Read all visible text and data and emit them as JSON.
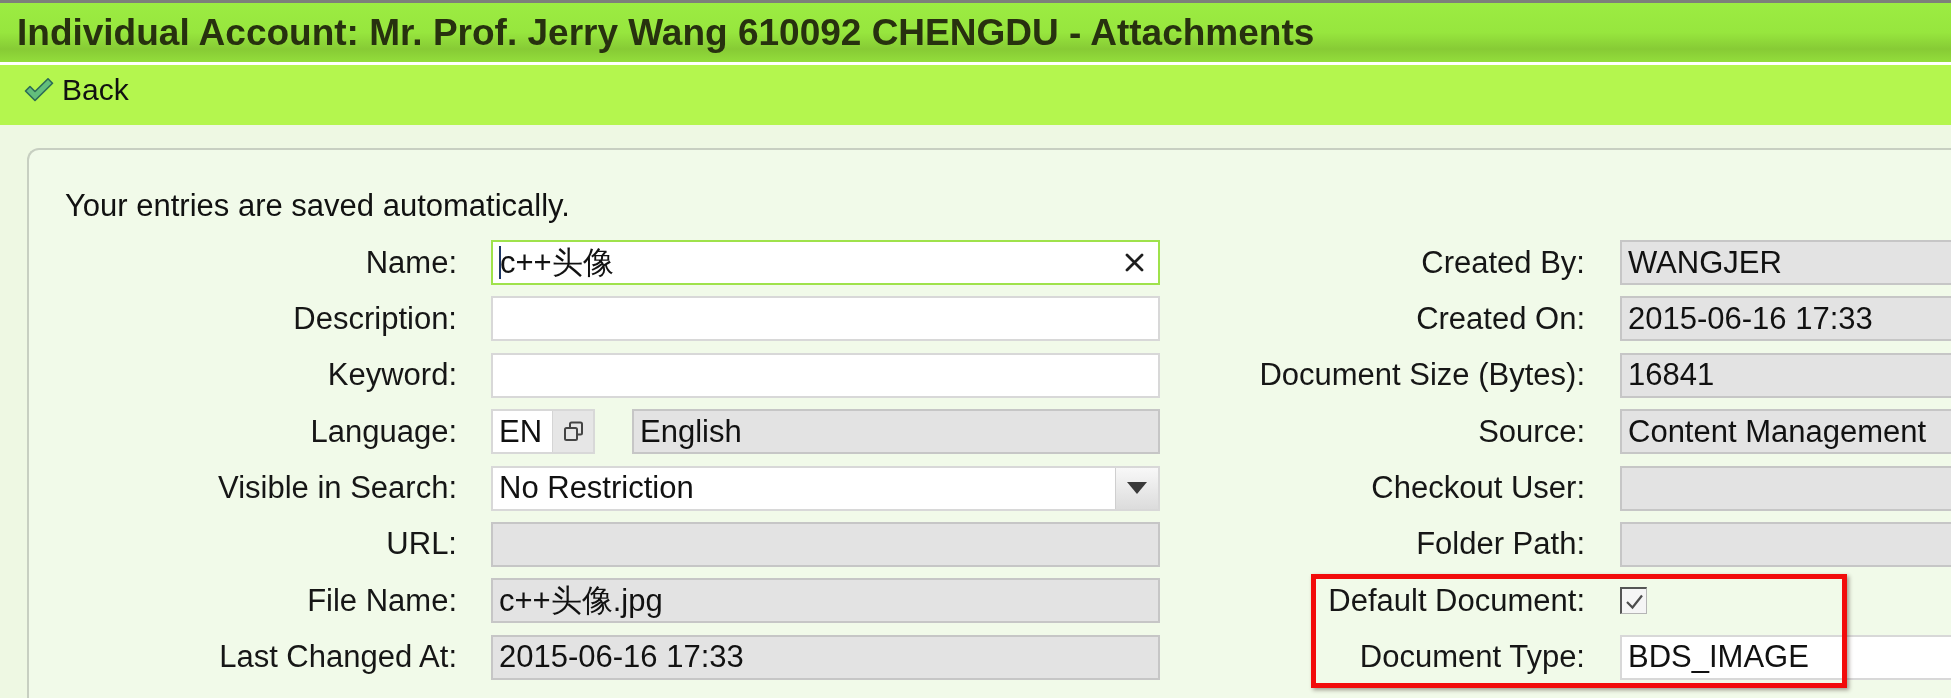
{
  "window": {
    "title": "Individual Account: Mr. Prof. Jerry Wang 610092 CHENGDU - Attachments"
  },
  "toolbar": {
    "buttons": [
      {
        "kind": "back",
        "label": "Back"
      }
    ]
  },
  "form": {
    "notice": "Your entries are saved automatically.",
    "left_fields": [
      {
        "label": "Name:",
        "kind": "text",
        "value": "c++头像",
        "editable": true,
        "focused": true
      },
      {
        "label": "Description:",
        "kind": "text",
        "editable": true,
        "focused": false
      },
      {
        "label": "Keyword:",
        "kind": "text",
        "editable": true,
        "focused": false
      },
      {
        "label": "Language:",
        "kind": "lookup",
        "code": "EN",
        "description": "English",
        "editable": true,
        "focused": false
      },
      {
        "label": "Visible in Search:",
        "kind": "select",
        "value": "No Restriction",
        "editable": true,
        "focused": false
      },
      {
        "label": "URL:",
        "kind": "text",
        "editable": false,
        "focused": false
      },
      {
        "label": "File Name:",
        "kind": "text",
        "value": "c++头像.jpg",
        "editable": false,
        "focused": false
      },
      {
        "label": "Last Changed At:",
        "kind": "text",
        "value": "2015-06-16 17:33",
        "editable": false,
        "focused": false
      }
    ],
    "right_fields": [
      {
        "label": "Created By:",
        "kind": "text",
        "value": "WANGJER",
        "editable": false,
        "highlighted": false
      },
      {
        "label": "Created On:",
        "kind": "text",
        "value": "2015-06-16 17:33",
        "editable": false,
        "highlighted": false
      },
      {
        "label": "Document Size (Bytes):",
        "kind": "text",
        "value": "16841",
        "editable": false,
        "highlighted": false
      },
      {
        "label": "Source:",
        "kind": "text",
        "value": "Content Management",
        "editable": false,
        "highlighted": false
      },
      {
        "label": "Checkout User:",
        "kind": "text",
        "editable": false,
        "highlighted": false
      },
      {
        "label": "Folder Path:",
        "kind": "text",
        "editable": false,
        "highlighted": false
      },
      {
        "label": "Default Document:",
        "kind": "checkbox",
        "checked": true,
        "highlighted": true
      },
      {
        "label": "Document Type:",
        "kind": "text",
        "value": "BDS_IMAGE",
        "editable": true,
        "highlighted": true
      }
    ]
  }
}
